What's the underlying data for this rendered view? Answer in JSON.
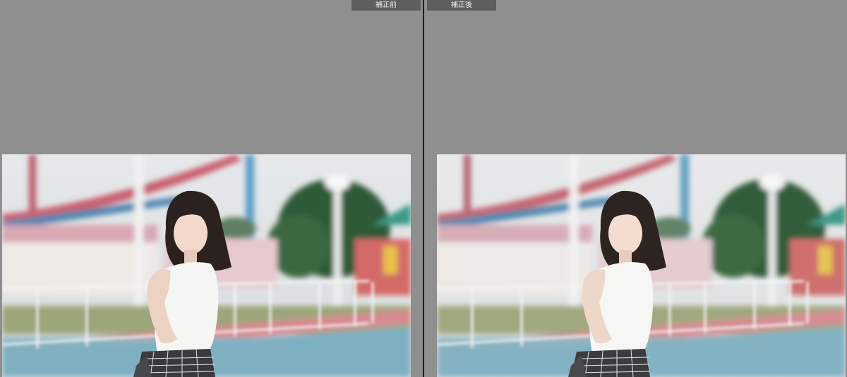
{
  "comparison": {
    "before_label": "補正前",
    "after_label": "補正後"
  },
  "photo": {
    "subject": "portrait-woman-amusement-park",
    "before_filter": "original",
    "after_filter": "color-corrected"
  }
}
